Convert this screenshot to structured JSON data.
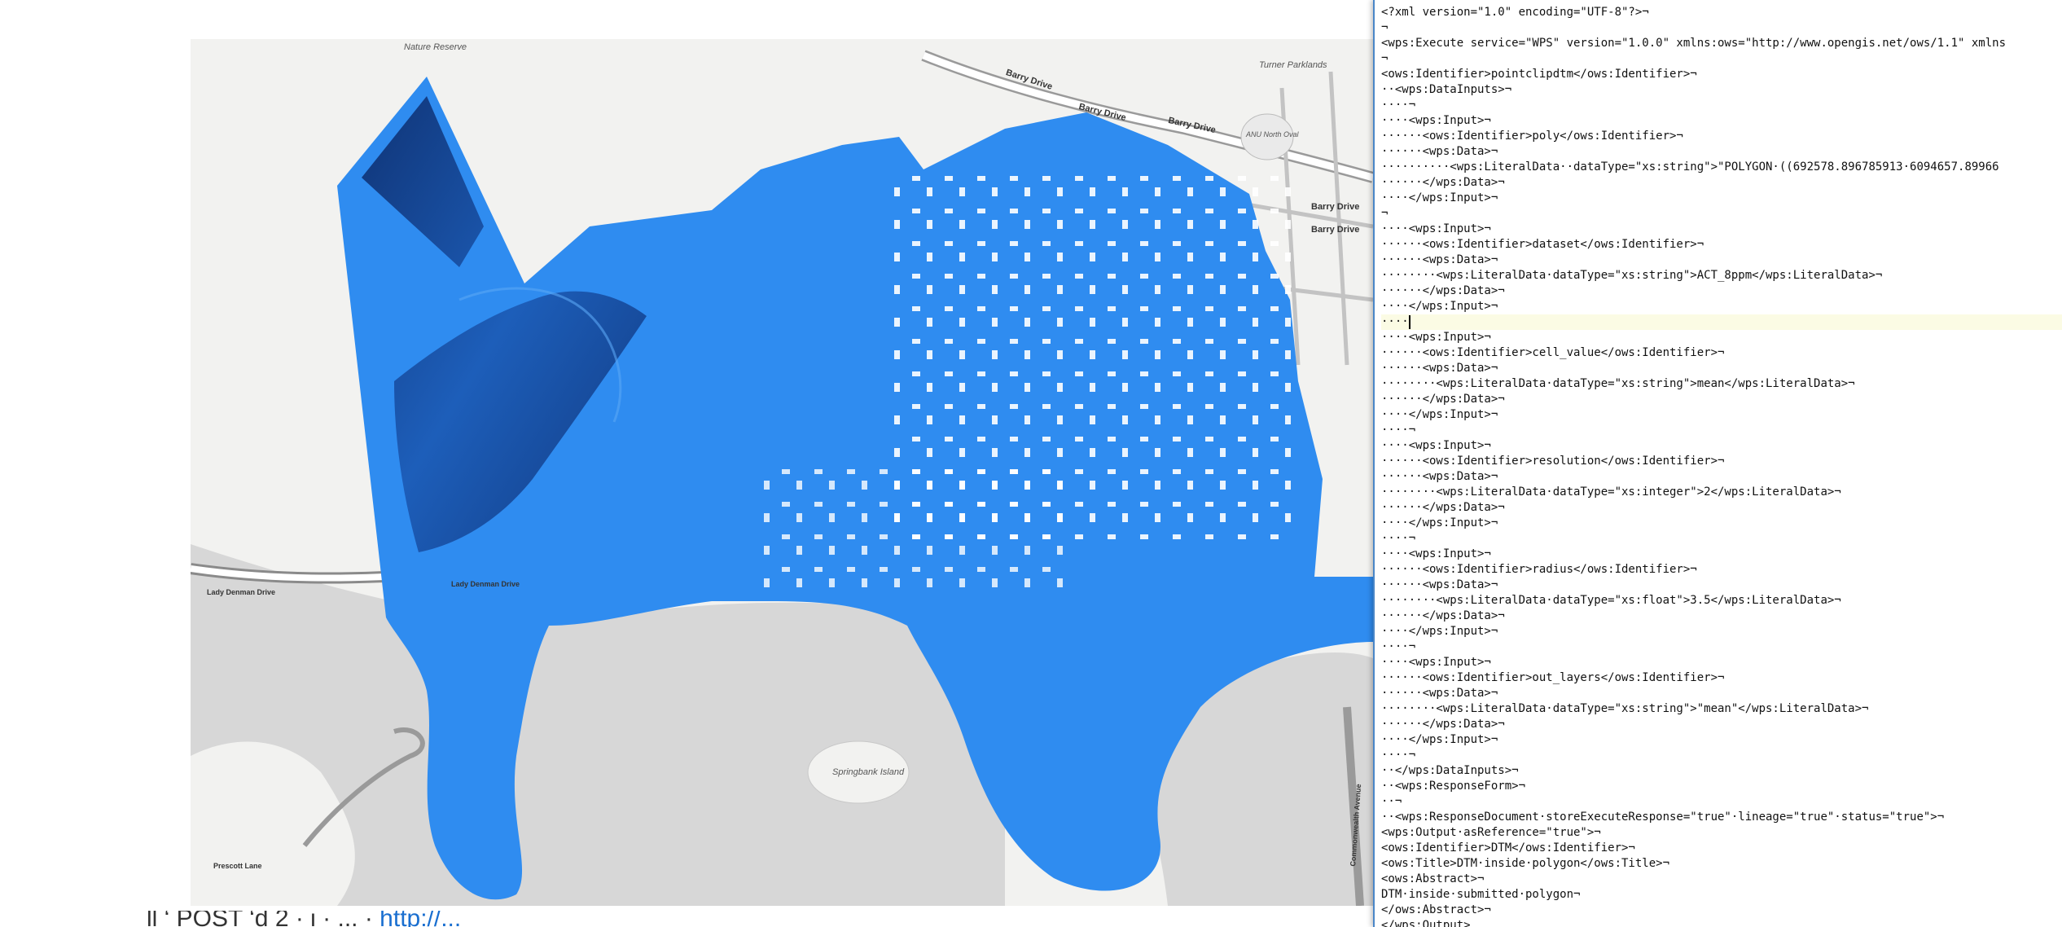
{
  "map": {
    "labels": {
      "nature_reserve": "Nature Reserve",
      "turner_parklands": "Turner Parklands",
      "anu_north_oval": "ANU North Oval",
      "barry_drive_1": "Barry Drive",
      "barry_drive_2": "Barry Drive",
      "barry_drive_3": "Barry Drive",
      "barry_drive_4": "Barry Drive",
      "barry_drive_5": "Barry Drive",
      "lady_denman_1": "Lady Denman Drive",
      "lady_denman_2": "Lady Denman Drive",
      "springbank": "Springbank Island",
      "prescott_lane": "Prescott Lane",
      "commonwealth_ave": "Commonwealth Avenue"
    },
    "colors": {
      "water": "#d7d7d7",
      "land": "#f2f2f0",
      "dtm_fill": "#2f8cf0",
      "dtm_dark": "#0b2a6b",
      "road": "#9a9a9a"
    }
  },
  "caption": {
    "prefix": "ll ‘ POST ‘d 2 · i · ... · ",
    "link": "http://..."
  },
  "editor": {
    "lines": [
      "<?xml version=\"1.0\" encoding=\"UTF-8\"?>¬",
      "¬",
      "<wps:Execute service=\"WPS\" version=\"1.0.0\" xmlns:ows=\"http://www.opengis.net/ows/1.1\" xmlns",
      "¬",
      "<ows:Identifier>pointclipdtm</ows:Identifier>¬",
      "··<wps:DataInputs>¬",
      "····¬",
      "····<wps:Input>¬",
      "······<ows:Identifier>poly</ows:Identifier>¬",
      "······<wps:Data>¬",
      "··········<wps:LiteralData··dataType=\"xs:string\">\"POLYGON·((692578.896785913·6094657.89966",
      "······</wps:Data>¬",
      "····</wps:Input>¬",
      "¬",
      "····<wps:Input>¬",
      "······<ows:Identifier>dataset</ows:Identifier>¬",
      "······<wps:Data>¬",
      "········<wps:LiteralData·dataType=\"xs:string\">ACT_8ppm</wps:LiteralData>¬",
      "······</wps:Data>¬",
      "····</wps:Input>¬",
      "····",
      "····<wps:Input>¬",
      "······<ows:Identifier>cell_value</ows:Identifier>¬",
      "······<wps:Data>¬",
      "········<wps:LiteralData·dataType=\"xs:string\">mean</wps:LiteralData>¬",
      "······</wps:Data>¬",
      "····</wps:Input>¬",
      "····¬",
      "····<wps:Input>¬",
      "······<ows:Identifier>resolution</ows:Identifier>¬",
      "······<wps:Data>¬",
      "········<wps:LiteralData·dataType=\"xs:integer\">2</wps:LiteralData>¬",
      "······</wps:Data>¬",
      "····</wps:Input>¬",
      "····¬",
      "····<wps:Input>¬",
      "······<ows:Identifier>radius</ows:Identifier>¬",
      "······<wps:Data>¬",
      "········<wps:LiteralData·dataType=\"xs:float\">3.5</wps:LiteralData>¬",
      "······</wps:Data>¬",
      "····</wps:Input>¬",
      "····¬",
      "····<wps:Input>¬",
      "······<ows:Identifier>out_layers</ows:Identifier>¬",
      "······<wps:Data>¬",
      "········<wps:LiteralData·dataType=\"xs:string\">\"mean\"</wps:LiteralData>¬",
      "······</wps:Data>¬",
      "····</wps:Input>¬",
      "····¬",
      "··</wps:DataInputs>¬",
      "··<wps:ResponseForm>¬",
      "··¬",
      "··<wps:ResponseDocument·storeExecuteResponse=\"true\"·lineage=\"true\"·status=\"true\">¬",
      "<wps:Output·asReference=\"true\">¬",
      "<ows:Identifier>DTM</ows:Identifier>¬",
      "<ows:Title>DTM·inside·polygon</ows:Title>¬",
      "<ows:Abstract>¬",
      "DTM·inside·submitted·polygon¬",
      "</ows:Abstract>¬",
      "</wps:Output>"
    ]
  }
}
